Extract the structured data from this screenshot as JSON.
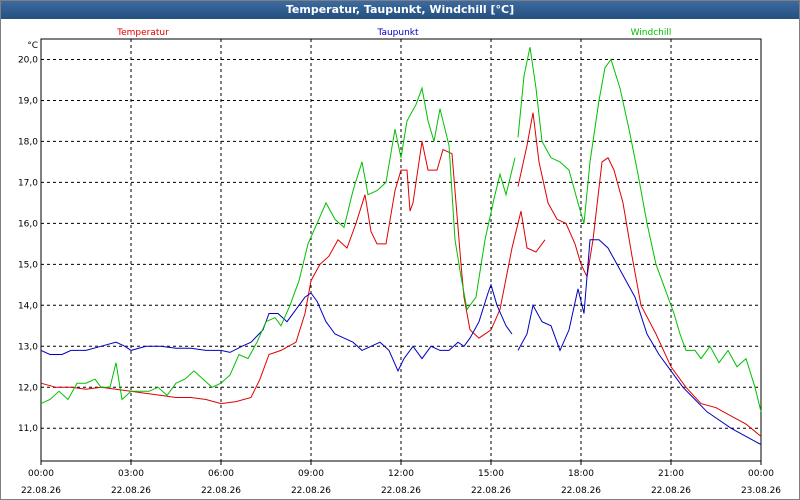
{
  "window": {
    "title": "Temperatur, Taupunkt, Windchill [°C]"
  },
  "chart_data": {
    "type": "line",
    "title": "Temperatur, Taupunkt, Windchill [°C]",
    "ylabel": "°C",
    "ylim": [
      10.2,
      20.5
    ],
    "xlim": [
      0,
      24
    ],
    "grid": true,
    "yticks": [
      11.0,
      12.0,
      13.0,
      14.0,
      15.0,
      16.0,
      17.0,
      18.0,
      19.0,
      20.0
    ],
    "ytick_labels": [
      "11,0",
      "12,0",
      "13,0",
      "14,0",
      "15,0",
      "16,0",
      "17,0",
      "18,0",
      "19,0",
      "20,0"
    ],
    "xticks": [
      0,
      3,
      6,
      9,
      12,
      15,
      18,
      21,
      24
    ],
    "xtick_times": [
      "00:00",
      "03:00",
      "06:00",
      "09:00",
      "12:00",
      "15:00",
      "18:00",
      "21:00",
      "00:00"
    ],
    "xtick_dates": [
      "22.08.26",
      "22.08.26",
      "22.08.26",
      "22.08.26",
      "22.08.26",
      "22.08.26",
      "22.08.26",
      "22.08.26",
      "23.08.26"
    ],
    "series": [
      {
        "name": "Temperatur",
        "color": "#e00000",
        "segments": [
          [
            [
              0.0,
              12.1
            ],
            [
              0.5,
              12.0
            ],
            [
              1.0,
              12.0
            ],
            [
              1.5,
              11.95
            ],
            [
              2.0,
              12.0
            ],
            [
              2.5,
              11.95
            ],
            [
              3.0,
              11.9
            ],
            [
              3.5,
              11.85
            ],
            [
              4.0,
              11.8
            ],
            [
              4.5,
              11.75
            ],
            [
              5.0,
              11.75
            ],
            [
              5.5,
              11.7
            ],
            [
              6.0,
              11.6
            ],
            [
              6.5,
              11.65
            ],
            [
              7.0,
              11.75
            ],
            [
              7.3,
              12.2
            ],
            [
              7.6,
              12.8
            ],
            [
              8.0,
              12.9
            ],
            [
              8.5,
              13.1
            ],
            [
              8.8,
              13.8
            ],
            [
              9.0,
              14.6
            ],
            [
              9.3,
              15.0
            ],
            [
              9.6,
              15.2
            ],
            [
              9.9,
              15.6
            ],
            [
              10.2,
              15.4
            ],
            [
              10.5,
              16.0
            ],
            [
              10.8,
              16.7
            ],
            [
              11.0,
              15.8
            ],
            [
              11.2,
              15.5
            ],
            [
              11.5,
              15.5
            ],
            [
              11.8,
              16.8
            ],
            [
              12.0,
              17.3
            ],
            [
              12.2,
              17.3
            ],
            [
              12.3,
              16.3
            ],
            [
              12.4,
              16.5
            ],
            [
              12.7,
              18.0
            ],
            [
              12.9,
              17.3
            ],
            [
              13.2,
              17.3
            ],
            [
              13.4,
              17.8
            ],
            [
              13.7,
              17.7
            ],
            [
              14.0,
              15.0
            ],
            [
              14.1,
              14.2
            ],
            [
              14.3,
              13.4
            ],
            [
              14.6,
              13.2
            ],
            [
              15.0,
              13.4
            ],
            [
              15.3,
              13.9
            ],
            [
              15.7,
              15.4
            ],
            [
              16.0,
              16.3
            ],
            [
              16.2,
              15.4
            ],
            [
              16.5,
              15.3
            ],
            [
              16.8,
              15.6
            ]
          ],
          [
            [
              15.9,
              16.9
            ],
            [
              16.2,
              17.9
            ],
            [
              16.4,
              18.7
            ],
            [
              16.6,
              17.5
            ],
            [
              16.9,
              16.5
            ],
            [
              17.2,
              16.1
            ],
            [
              17.5,
              16.0
            ],
            [
              17.8,
              15.5
            ],
            [
              18.0,
              15.0
            ],
            [
              18.2,
              14.7
            ],
            [
              18.4,
              15.6
            ],
            [
              18.7,
              17.5
            ],
            [
              18.9,
              17.6
            ],
            [
              19.1,
              17.3
            ],
            [
              19.4,
              16.5
            ],
            [
              19.7,
              15.2
            ],
            [
              20.0,
              14.0
            ],
            [
              20.5,
              13.3
            ],
            [
              21.0,
              12.5
            ],
            [
              21.5,
              12.0
            ],
            [
              22.0,
              11.6
            ],
            [
              22.5,
              11.5
            ],
            [
              23.0,
              11.3
            ],
            [
              23.5,
              11.1
            ],
            [
              24.0,
              10.8
            ]
          ]
        ]
      },
      {
        "name": "Taupunkt",
        "color": "#0000c0",
        "segments": [
          [
            [
              0.0,
              12.9
            ],
            [
              0.3,
              12.8
            ],
            [
              0.7,
              12.8
            ],
            [
              1.0,
              12.9
            ],
            [
              1.5,
              12.9
            ],
            [
              2.0,
              13.0
            ],
            [
              2.5,
              13.1
            ],
            [
              2.8,
              13.0
            ],
            [
              3.0,
              12.9
            ],
            [
              3.5,
              13.0
            ],
            [
              4.0,
              13.0
            ],
            [
              4.5,
              12.95
            ],
            [
              5.0,
              12.95
            ],
            [
              5.5,
              12.9
            ],
            [
              6.0,
              12.9
            ],
            [
              6.3,
              12.85
            ],
            [
              6.7,
              13.0
            ],
            [
              7.0,
              13.1
            ],
            [
              7.4,
              13.4
            ],
            [
              7.6,
              13.8
            ],
            [
              7.9,
              13.8
            ],
            [
              8.2,
              13.6
            ],
            [
              8.5,
              13.9
            ],
            [
              8.8,
              14.2
            ],
            [
              9.0,
              14.3
            ],
            [
              9.2,
              14.1
            ],
            [
              9.5,
              13.6
            ],
            [
              9.8,
              13.3
            ],
            [
              10.1,
              13.2
            ],
            [
              10.4,
              13.1
            ],
            [
              10.7,
              12.9
            ],
            [
              11.0,
              13.0
            ],
            [
              11.3,
              13.1
            ],
            [
              11.6,
              12.9
            ],
            [
              11.9,
              12.4
            ],
            [
              12.1,
              12.7
            ],
            [
              12.4,
              13.0
            ],
            [
              12.7,
              12.7
            ],
            [
              13.0,
              13.0
            ],
            [
              13.3,
              12.9
            ],
            [
              13.6,
              12.9
            ],
            [
              13.9,
              13.1
            ],
            [
              14.1,
              13.0
            ],
            [
              14.3,
              13.2
            ],
            [
              14.6,
              13.6
            ],
            [
              14.9,
              14.3
            ],
            [
              15.0,
              14.5
            ],
            [
              15.2,
              14.0
            ],
            [
              15.5,
              13.5
            ],
            [
              15.7,
              13.3
            ]
          ],
          [
            [
              15.9,
              12.9
            ],
            [
              16.2,
              13.3
            ],
            [
              16.4,
              14.0
            ],
            [
              16.7,
              13.6
            ],
            [
              17.0,
              13.5
            ],
            [
              17.3,
              12.9
            ],
            [
              17.6,
              13.4
            ],
            [
              17.9,
              14.4
            ],
            [
              18.1,
              13.8
            ],
            [
              18.3,
              15.6
            ],
            [
              18.6,
              15.6
            ],
            [
              18.9,
              15.4
            ],
            [
              19.2,
              15.0
            ],
            [
              19.5,
              14.6
            ],
            [
              19.8,
              14.2
            ],
            [
              20.2,
              13.3
            ],
            [
              20.6,
              12.8
            ],
            [
              21.0,
              12.4
            ],
            [
              21.4,
              12.0
            ],
            [
              21.8,
              11.7
            ],
            [
              22.2,
              11.4
            ],
            [
              22.6,
              11.2
            ],
            [
              23.0,
              11.0
            ],
            [
              23.5,
              10.8
            ],
            [
              24.0,
              10.6
            ]
          ]
        ]
      },
      {
        "name": "Windchill",
        "color": "#00c000",
        "segments": [
          [
            [
              0.0,
              11.6
            ],
            [
              0.3,
              11.7
            ],
            [
              0.6,
              11.9
            ],
            [
              0.9,
              11.7
            ],
            [
              1.2,
              12.1
            ],
            [
              1.5,
              12.1
            ],
            [
              1.8,
              12.2
            ],
            [
              2.0,
              12.0
            ],
            [
              2.3,
              12.0
            ],
            [
              2.5,
              12.6
            ],
            [
              2.7,
              11.7
            ],
            [
              3.0,
              11.9
            ],
            [
              3.3,
              11.9
            ],
            [
              3.6,
              11.9
            ],
            [
              3.9,
              12.0
            ],
            [
              4.2,
              11.8
            ],
            [
              4.5,
              12.1
            ],
            [
              4.8,
              12.2
            ],
            [
              5.1,
              12.4
            ],
            [
              5.4,
              12.2
            ],
            [
              5.7,
              12.0
            ],
            [
              6.0,
              12.1
            ],
            [
              6.3,
              12.3
            ],
            [
              6.6,
              12.8
            ],
            [
              6.9,
              12.7
            ],
            [
              7.2,
              13.1
            ],
            [
              7.5,
              13.6
            ],
            [
              7.8,
              13.7
            ],
            [
              8.0,
              13.5
            ],
            [
              8.3,
              14.0
            ],
            [
              8.6,
              14.6
            ],
            [
              8.9,
              15.5
            ],
            [
              9.2,
              16.0
            ],
            [
              9.5,
              16.5
            ],
            [
              9.8,
              16.1
            ],
            [
              10.1,
              15.9
            ],
            [
              10.4,
              16.8
            ],
            [
              10.7,
              17.5
            ],
            [
              10.9,
              16.7
            ],
            [
              11.2,
              16.8
            ],
            [
              11.5,
              17.0
            ],
            [
              11.8,
              18.3
            ],
            [
              12.0,
              17.6
            ],
            [
              12.2,
              18.5
            ],
            [
              12.5,
              18.9
            ],
            [
              12.7,
              19.3
            ],
            [
              12.9,
              18.5
            ],
            [
              13.1,
              18.0
            ],
            [
              13.3,
              18.8
            ],
            [
              13.6,
              17.9
            ],
            [
              13.8,
              15.6
            ],
            [
              14.0,
              14.7
            ],
            [
              14.2,
              13.9
            ],
            [
              14.5,
              14.2
            ],
            [
              14.8,
              15.6
            ],
            [
              15.1,
              16.6
            ],
            [
              15.3,
              17.2
            ],
            [
              15.5,
              16.7
            ],
            [
              15.8,
              17.6
            ]
          ],
          [
            [
              15.9,
              18.1
            ],
            [
              16.1,
              19.6
            ],
            [
              16.3,
              20.3
            ],
            [
              16.5,
              19.3
            ],
            [
              16.7,
              18.0
            ],
            [
              17.0,
              17.6
            ],
            [
              17.3,
              17.5
            ],
            [
              17.6,
              17.3
            ],
            [
              17.9,
              16.5
            ],
            [
              18.1,
              16.0
            ],
            [
              18.3,
              17.5
            ],
            [
              18.6,
              19.0
            ],
            [
              18.8,
              19.8
            ],
            [
              19.0,
              20.0
            ],
            [
              19.3,
              19.3
            ],
            [
              19.6,
              18.3
            ],
            [
              19.9,
              17.2
            ],
            [
              20.2,
              16.0
            ],
            [
              20.5,
              15.0
            ],
            [
              20.8,
              14.4
            ],
            [
              21.1,
              13.8
            ],
            [
              21.3,
              13.3
            ],
            [
              21.5,
              12.9
            ],
            [
              21.8,
              12.9
            ],
            [
              22.0,
              12.7
            ],
            [
              22.3,
              13.0
            ],
            [
              22.6,
              12.6
            ],
            [
              22.9,
              12.9
            ],
            [
              23.2,
              12.5
            ],
            [
              23.5,
              12.7
            ],
            [
              23.8,
              12.0
            ],
            [
              24.0,
              11.4
            ]
          ]
        ]
      }
    ]
  }
}
